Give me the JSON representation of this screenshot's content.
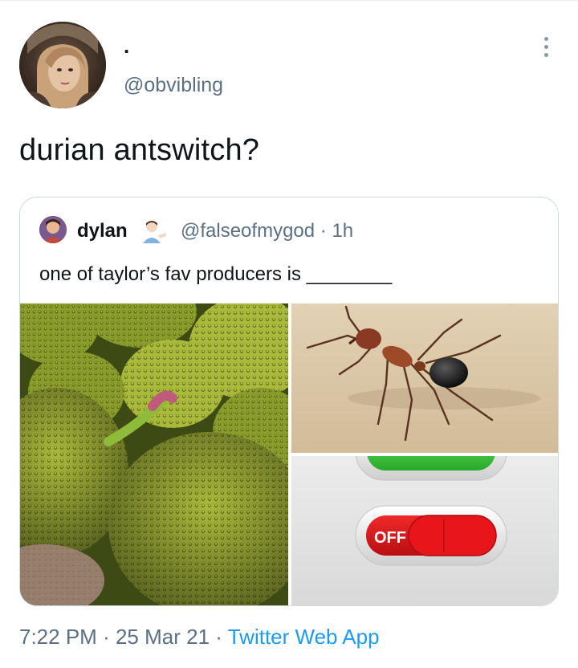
{
  "tweet": {
    "display_name": ".",
    "handle": "@obvibling",
    "text": "durian antswitch?",
    "time": "7:22 PM",
    "sep1": "·",
    "date": "25 Mar 21",
    "sep2": "·",
    "source": "Twitter Web App"
  },
  "quote": {
    "name": "dylan",
    "emoji": "man-tipping-hand",
    "handle_time": "@falseofmygod · 1h",
    "text": "one of taylor’s fav producers is ________",
    "images": [
      "durian-photo",
      "ant-photo",
      "off-switch-photo"
    ],
    "switch_label": "OFF"
  },
  "colors": {
    "secondary_text": "#5b7083",
    "link": "#1d9bf0",
    "border": "#cfd9de",
    "switch_red": "#d8141a",
    "switch_green": "#3ec43e"
  }
}
